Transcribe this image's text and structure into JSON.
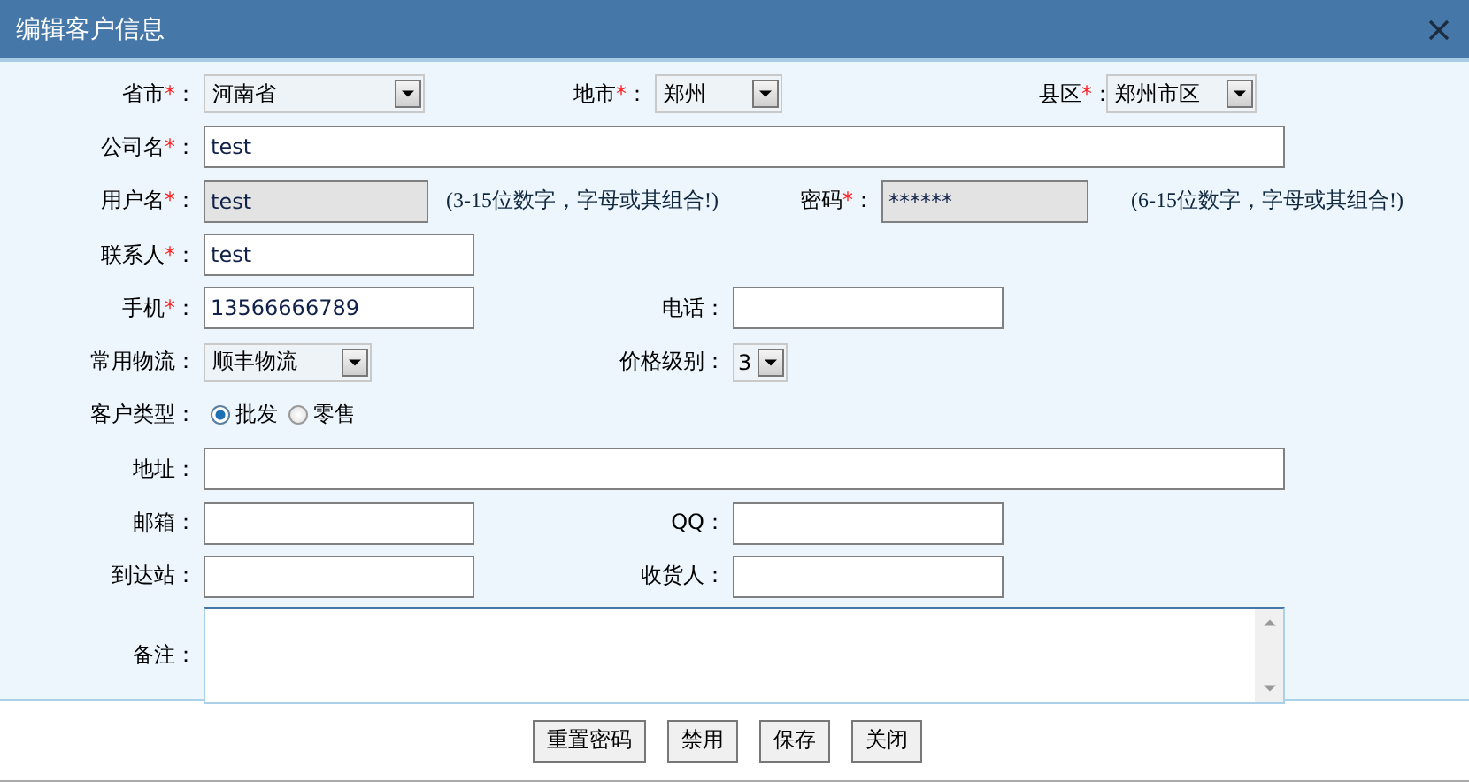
{
  "window": {
    "title": "编辑客户信息"
  },
  "rows": [
    {
      "fields": [
        {
          "kind": "select",
          "label": "省市",
          "required": "*",
          "colon": "：",
          "value": "河南省"
        },
        {
          "kind": "select",
          "label": "地市",
          "required": "*",
          "colon": "：",
          "value": "郑州"
        },
        {
          "kind": "select",
          "label": "县区",
          "required": "*",
          "colon": "：",
          "value": "郑州市区"
        }
      ]
    },
    {
      "fields": [
        {
          "kind": "input",
          "label": "公司名",
          "required": "*",
          "colon": "：",
          "value": "test",
          "disabled": false
        }
      ]
    },
    {
      "fields": [
        {
          "kind": "input",
          "label": "用户名",
          "required": "*",
          "colon": "：",
          "value": "test",
          "disabled": true,
          "hint": "(3-15位数字，字母或其组合!)"
        },
        {
          "kind": "input",
          "label": "密码",
          "required": "*",
          "colon": "：",
          "value": "******",
          "disabled": true,
          "hint": "(6-15位数字，字母或其组合!)"
        }
      ]
    },
    {
      "fields": [
        {
          "kind": "input",
          "label": "联系人",
          "required": "*",
          "colon": "：",
          "value": "test",
          "disabled": false
        }
      ]
    },
    {
      "fields": [
        {
          "kind": "input",
          "label": "手机",
          "required": "*",
          "colon": "：",
          "value": "13566666789",
          "disabled": false
        },
        {
          "kind": "input",
          "label": "电话",
          "colon": "：",
          "disabled": false
        }
      ]
    },
    {
      "fields": [
        {
          "kind": "select",
          "label": "常用物流",
          "colon": "：",
          "value": "顺丰物流"
        },
        {
          "kind": "select",
          "label": "价格级别",
          "colon": "：",
          "value": "3"
        }
      ]
    },
    {
      "fields": [
        {
          "kind": "radio",
          "label": "客户类型",
          "colon": "：",
          "options": [
            {
              "label": "批发",
              "selected": true
            },
            {
              "label": "零售",
              "selected": false
            }
          ]
        }
      ]
    },
    {
      "fields": [
        {
          "kind": "input",
          "label": "地址",
          "colon": "：",
          "disabled": false
        }
      ]
    },
    {
      "fields": [
        {
          "kind": "input",
          "label": "邮箱",
          "colon": "：",
          "disabled": false
        },
        {
          "kind": "input",
          "label": "QQ",
          "colon": "：",
          "disabled": false
        }
      ]
    },
    {
      "fields": [
        {
          "kind": "input",
          "label": "到达站",
          "colon": "：",
          "disabled": false
        },
        {
          "kind": "input",
          "label": "收货人",
          "colon": "：",
          "disabled": false
        }
      ]
    },
    {
      "fields": [
        {
          "kind": "textarea",
          "label": "备注",
          "colon": "：",
          "focused": true
        }
      ]
    }
  ],
  "buttons": [
    "重置密码",
    "禁用",
    "保存",
    "关闭"
  ]
}
